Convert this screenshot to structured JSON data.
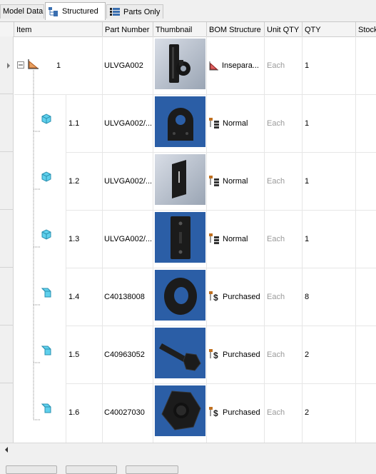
{
  "tabs": [
    {
      "label": "Model Data",
      "active": false
    },
    {
      "label": "Structured",
      "active": true
    },
    {
      "label": "Parts Only",
      "active": false
    }
  ],
  "columns": [
    "Item",
    "Part Number",
    "Thumbnail",
    "BOM Structure",
    "Unit QTY",
    "QTY",
    "Stock"
  ],
  "rows": [
    {
      "item": "1",
      "part_number": "ULVGA002",
      "bom_structure": "Insepara...",
      "unit_qty": "Each",
      "qty": "1",
      "type": "assembly",
      "thumb": "assembly-bracket-thumbnail"
    },
    {
      "item": "1.1",
      "part_number": "ULVGA002/...",
      "bom_structure": "Normal",
      "unit_qty": "Each",
      "qty": "1",
      "type": "part",
      "thumb": "lug-plate-thumbnail"
    },
    {
      "item": "1.2",
      "part_number": "ULVGA002/...",
      "bom_structure": "Normal",
      "unit_qty": "Each",
      "qty": "1",
      "type": "part",
      "thumb": "slotted-plate-thumbnail"
    },
    {
      "item": "1.3",
      "part_number": "ULVGA002/...",
      "bom_structure": "Normal",
      "unit_qty": "Each",
      "qty": "1",
      "type": "part",
      "thumb": "backing-plate-thumbnail"
    },
    {
      "item": "1.4",
      "part_number": "C40138008",
      "bom_structure": "Purchased",
      "unit_qty": "Each",
      "qty": "8",
      "type": "purchased",
      "thumb": "washer-thumbnail"
    },
    {
      "item": "1.5",
      "part_number": "C40963052",
      "bom_structure": "Purchased",
      "unit_qty": "Each",
      "qty": "2",
      "type": "purchased",
      "thumb": "bolt-thumbnail"
    },
    {
      "item": "1.6",
      "part_number": "C40027030",
      "bom_structure": "Purchased",
      "unit_qty": "Each",
      "qty": "2",
      "type": "purchased",
      "thumb": "hex-nut-thumbnail"
    }
  ],
  "colors": {
    "thumb_bg": "#2b5ea6",
    "assembly_thumb_bg": "#aab4c2",
    "part_icon": "#4fc3e0",
    "dim_text": "#9a9a9a"
  }
}
